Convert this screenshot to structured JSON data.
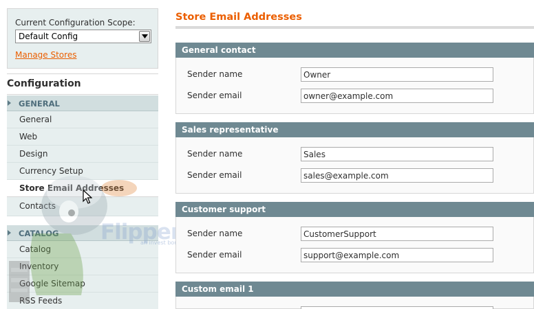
{
  "scope": {
    "label": "Current Configuration Scope:",
    "selected": "Default Config",
    "manage_link": "Manage Stores"
  },
  "sidebar": {
    "title": "Configuration",
    "groups": [
      {
        "label": "GENERAL",
        "items": [
          {
            "label": "General"
          },
          {
            "label": "Web"
          },
          {
            "label": "Design"
          },
          {
            "label": "Currency Setup"
          },
          {
            "label": "Store Email Addresses",
            "active": true
          },
          {
            "label": "Contacts"
          }
        ]
      },
      {
        "label": "CATALOG",
        "items": [
          {
            "label": "Catalog"
          },
          {
            "label": "Inventory"
          },
          {
            "label": "Google Sitemap"
          },
          {
            "label": "RSS Feeds"
          }
        ]
      }
    ]
  },
  "main": {
    "title": "Store Email Addresses",
    "sections": [
      {
        "title": "General contact",
        "fields": [
          {
            "label": "Sender name",
            "value": "Owner"
          },
          {
            "label": "Sender email",
            "value": "owner@example.com"
          }
        ]
      },
      {
        "title": "Sales representative",
        "fields": [
          {
            "label": "Sender name",
            "value": "Sales"
          },
          {
            "label": "Sender email",
            "value": "sales@example.com"
          }
        ]
      },
      {
        "title": "Customer support",
        "fields": [
          {
            "label": "Sender name",
            "value": "CustomerSupport"
          },
          {
            "label": "Sender email",
            "value": "support@example.com"
          }
        ]
      },
      {
        "title": "Custom email 1"
      }
    ]
  },
  "watermark": {
    "brand": "FlipperHost",
    "tagline": "an invest bon company"
  },
  "colors": {
    "accent": "#eb5e00",
    "section_header": "#6f8992",
    "sidebar_bg": "#e7efef",
    "group_header_bg": "#d1dedf"
  }
}
